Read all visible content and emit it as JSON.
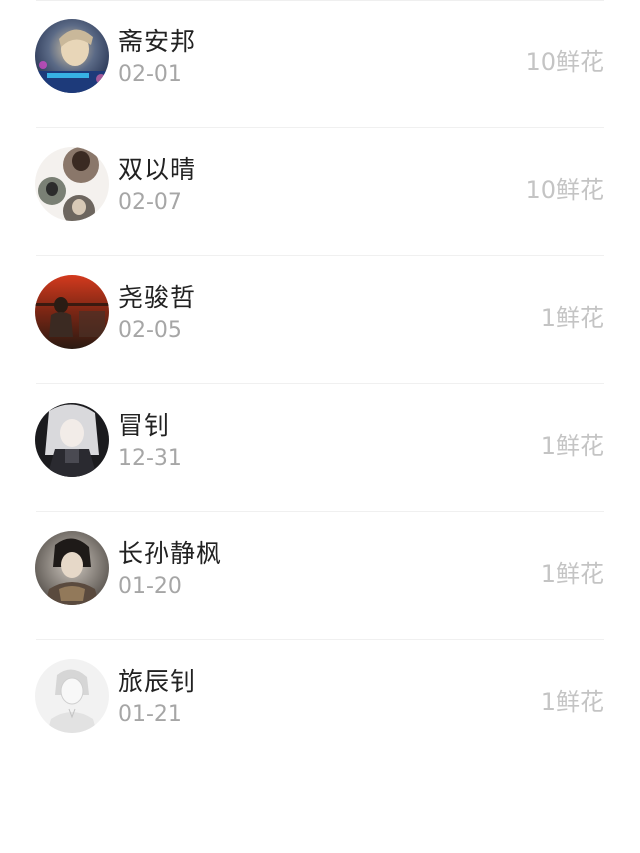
{
  "gift_list": {
    "items": [
      {
        "name": "斋安邦",
        "date": "02-01",
        "flowers": "10鲜花",
        "avatar_icon": "user-avatar-neon-portrait"
      },
      {
        "name": "双以晴",
        "date": "02-07",
        "flowers": "10鲜花",
        "avatar_icon": "user-avatar-collage"
      },
      {
        "name": "尧骏哲",
        "date": "02-05",
        "flowers": "1鲜花",
        "avatar_icon": "user-avatar-sunset-figure"
      },
      {
        "name": "冒钊",
        "date": "12-31",
        "flowers": "1鲜花",
        "avatar_icon": "user-avatar-anime-dark"
      },
      {
        "name": "长孙静枫",
        "date": "01-20",
        "flowers": "1鲜花",
        "avatar_icon": "user-avatar-anime-boy"
      },
      {
        "name": "旅辰钊",
        "date": "01-21",
        "flowers": "1鲜花",
        "avatar_icon": "user-avatar-sketch"
      }
    ]
  },
  "colors": {
    "name_text": "#222222",
    "date_text": "#a6a6a6",
    "flowers_text": "#c4c4c4",
    "divider": "#f0f0f0"
  }
}
